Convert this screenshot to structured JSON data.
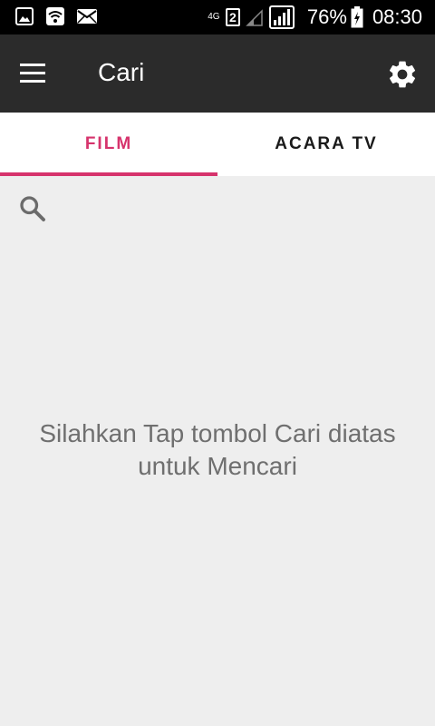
{
  "status_bar": {
    "network_label": "4G",
    "sim_slot": "2",
    "battery_percent": "76%",
    "time": "08:30",
    "icons": [
      "image-icon",
      "wifi-icon",
      "mail-icon",
      "signal-icon",
      "battery-icon"
    ]
  },
  "app_bar": {
    "title": "Cari",
    "menu_icon": "hamburger-menu-icon",
    "settings_icon": "gear-icon"
  },
  "tabs": [
    {
      "label": "FILM",
      "active": true
    },
    {
      "label": "ACARA TV",
      "active": false
    }
  ],
  "content": {
    "search_icon": "search-icon",
    "empty_message": "Silahkan Tap tombol Cari diatas untuk Mencari"
  },
  "colors": {
    "status_bar": "#000000",
    "app_bar": "#2b2b2b",
    "accent": "#d6336c",
    "background": "#eeeeee",
    "message_text": "#6f6f6f"
  }
}
